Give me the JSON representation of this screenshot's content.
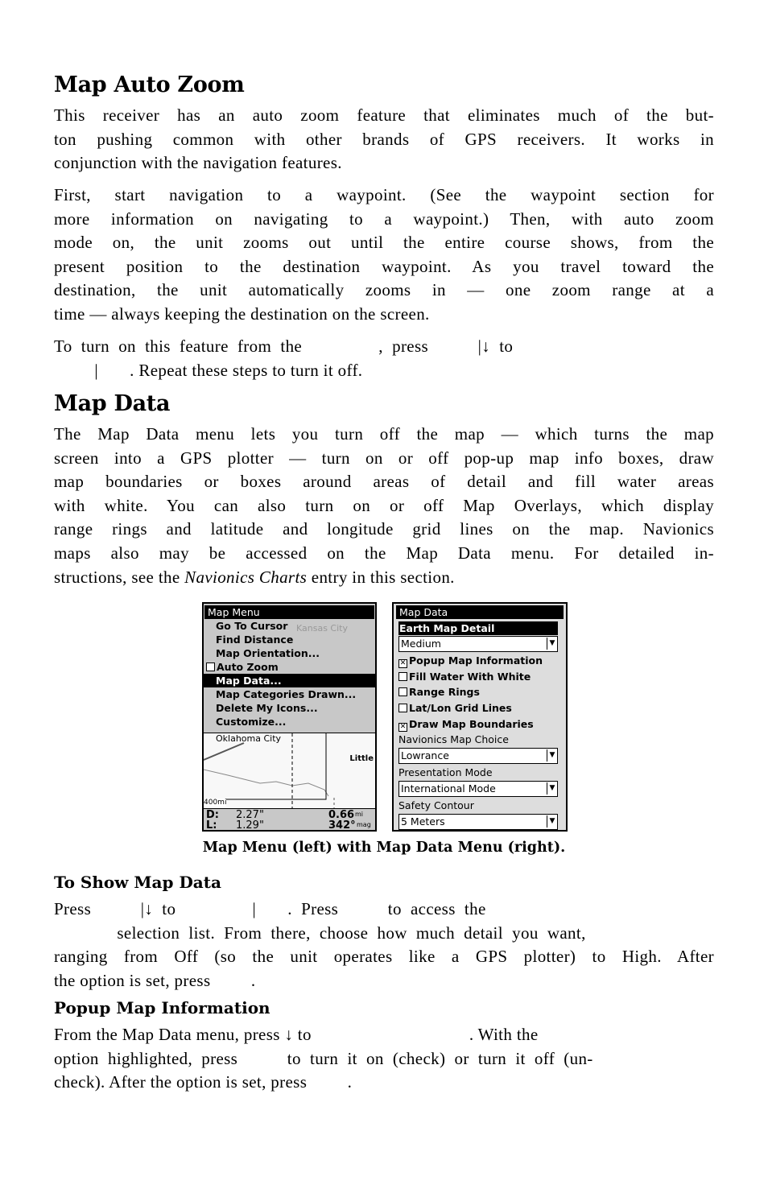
{
  "section1": {
    "title": "Map Auto Zoom",
    "p1": [
      "This receiver has an auto zoom feature that eliminates much of the but-",
      "ton pushing common with other brands of GPS receivers. It works in",
      "conjunction with the navigation features."
    ],
    "p2": [
      "First, start navigation to a waypoint. (See the waypoint section for",
      "more information on navigating to a waypoint.) Then, with auto zoom",
      "mode on, the unit zooms out until the entire course shows, from the",
      "present position to the destination waypoint. As you travel toward the",
      "destination, the unit automatically zooms in — one zoom range at a",
      "time — always keeping the destination on the screen."
    ],
    "p3": [
      "To  turn  on  this  feature  from  the                 ,  press           |↓  to",
      "         |       . Repeat these steps to turn it off."
    ]
  },
  "section2": {
    "title": "Map Data",
    "p1": [
      "The Map Data menu lets you turn off the map — which turns the map",
      "screen into a GPS plotter — turn on or off pop-up map info boxes, draw",
      "map boundaries or boxes around areas of detail and fill water areas",
      "with white. You can also turn on or off Map Overlays, which display",
      "range rings and latitude and longitude grid lines on the map. Navionics",
      "maps also may be accessed on the Map Data menu. For detailed in-"
    ],
    "p1_last_pre": "structions, see the ",
    "p1_last_italic": "Navionics Charts",
    "p1_last_post": " entry in this section.",
    "caption": "Map Menu (left) with Map Data Menu (right)."
  },
  "map_menu": {
    "title": "Map Menu",
    "items": [
      "Go To Cursor",
      "Find Distance",
      "Map Orientation...",
      "Auto Zoom",
      "Map Data...",
      "Map Categories Drawn...",
      "Delete My Icons...",
      "Customize..."
    ],
    "map_labels": {
      "city1": "Oklahoma City",
      "city2": "Little",
      "city3": "Kansas City",
      "scale": "400mi"
    },
    "status": {
      "d_label": "D:",
      "d_val": "2.27\"",
      "l_label": "L:",
      "l_val": "1.29\"",
      "dist": "0.66",
      "dist_unit": "mi",
      "bearing": "342°",
      "bearing_unit": "mag"
    }
  },
  "map_data": {
    "title": "Map Data",
    "earth_label": "Earth Map Detail",
    "earth_value": "Medium",
    "checks": [
      {
        "label": "Popup Map Information",
        "checked": true
      },
      {
        "label": "Fill Water With White",
        "checked": false
      },
      {
        "label": "Range Rings",
        "checked": false
      },
      {
        "label": "Lat/Lon Grid Lines",
        "checked": false
      },
      {
        "label": "Draw Map Boundaries",
        "checked": true
      }
    ],
    "nav_label": "Navionics Map Choice",
    "nav_value": "Lowrance",
    "pres_label": "Presentation Mode",
    "pres_value": "International Mode",
    "safety_label": "Safety Contour",
    "safety_value": "5 Meters"
  },
  "section3": {
    "title": "To Show Map Data",
    "lines": [
      "Press           |↓  to                 |       .  Press           to  access  the",
      "              selection  list.  From  there,  choose  how  much  detail  you  want,",
      "ranging from Off (so the unit operates like a GPS plotter) to High. After",
      "the option is set, press         ."
    ]
  },
  "section4": {
    "title": "Popup Map Information",
    "lines": [
      "From the Map Data menu, press ↓ to                                   . With the",
      "option  highlighted,  press           to  turn  it  on  (check)  or  turn  it  off  (un-",
      "check). After the option is set, press         ."
    ]
  }
}
